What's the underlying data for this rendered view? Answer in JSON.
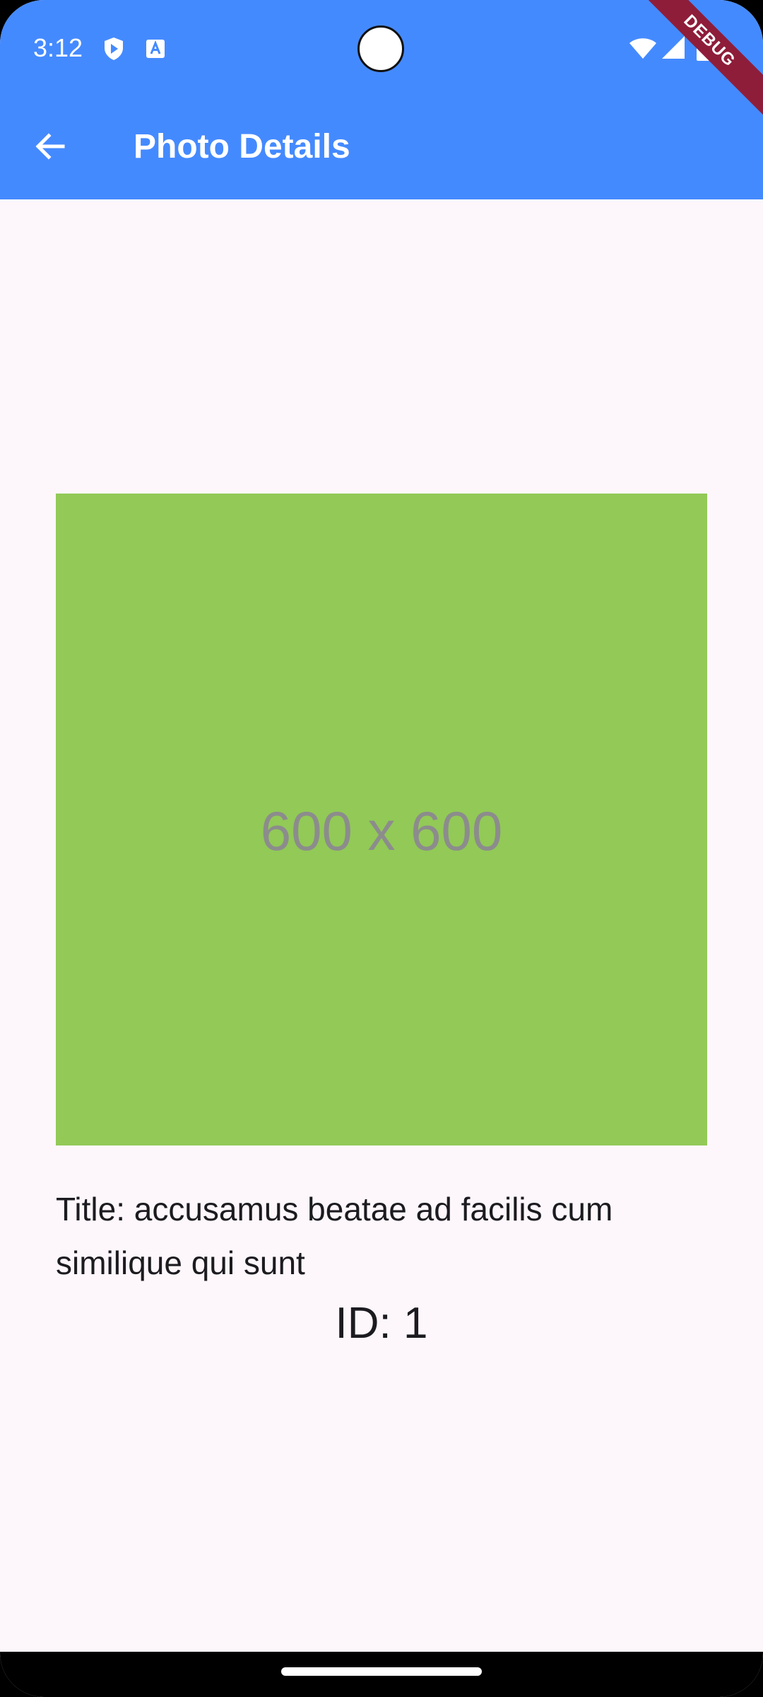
{
  "status_bar": {
    "time": "3:12",
    "icons": [
      "play-protect-icon",
      "font-notification-icon",
      "wifi-icon",
      "signal-icon",
      "battery-icon"
    ]
  },
  "app_bar": {
    "title": "Photo Details",
    "back_icon": "arrow-back-icon",
    "background_color": "#448aff"
  },
  "debug_banner": {
    "label": "DEBUG",
    "color": "#8e1d3a"
  },
  "photo": {
    "placeholder_text": "600 x 600",
    "background_color": "#92c957"
  },
  "details": {
    "title": "Title: accusamus beatae ad facilis cum similique qui sunt",
    "id": "ID: 1"
  }
}
